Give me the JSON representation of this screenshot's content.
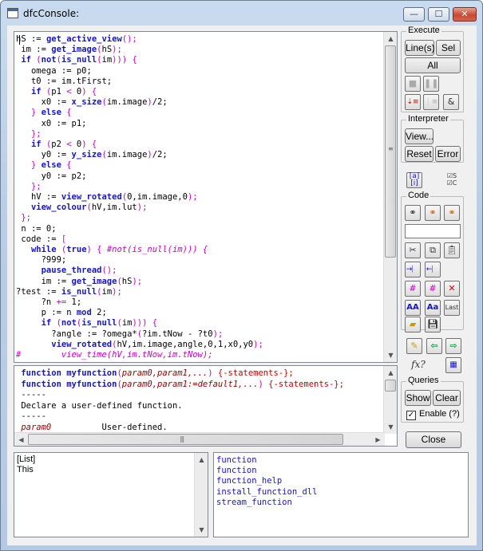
{
  "window": {
    "title": "dfcConsole:",
    "min": "—",
    "max": "☐",
    "close": "✕"
  },
  "editor": {
    "lines": [
      [
        [
          "",
          "hS := "
        ],
        [
          "fn",
          "get_active_view"
        ],
        [
          "sym",
          "();"
        ]
      ],
      [
        [
          "",
          " im := "
        ],
        [
          "fn",
          "get_image"
        ],
        [
          "sym",
          "("
        ],
        [
          "",
          "hS"
        ],
        [
          "sym",
          ");"
        ]
      ],
      [
        [
          "kw",
          " if"
        ],
        [
          "",
          " "
        ],
        [
          "sym",
          "("
        ],
        [
          "kw",
          "not"
        ],
        [
          "sym",
          "("
        ],
        [
          "kw",
          "is_null"
        ],
        [
          "sym",
          "("
        ],
        [
          "",
          "im"
        ],
        [
          "sym",
          "))) {"
        ]
      ],
      [
        [
          "",
          "   omega := p0;"
        ]
      ],
      [
        [
          "",
          "   t0 := im.tFirst;"
        ]
      ],
      [
        [
          "kw",
          "   if"
        ],
        [
          "",
          " "
        ],
        [
          "sym",
          "("
        ],
        [
          "",
          "p1 "
        ],
        [
          "sym",
          "<"
        ],
        [
          "",
          " 0"
        ],
        [
          "sym",
          ") {"
        ]
      ],
      [
        [
          "",
          "     x0 := "
        ],
        [
          "fn",
          "x_size"
        ],
        [
          "sym",
          "("
        ],
        [
          "",
          "im.image"
        ],
        [
          "sym",
          ")"
        ],
        [
          "",
          "/2;"
        ]
      ],
      [
        [
          "sym",
          "   } "
        ],
        [
          "kw",
          "else"
        ],
        [
          "sym",
          " {"
        ]
      ],
      [
        [
          "",
          "     x0 := p1;"
        ]
      ],
      [
        [
          "sym",
          "   };"
        ]
      ],
      [
        [
          "kw",
          "   if"
        ],
        [
          "",
          " "
        ],
        [
          "sym",
          "("
        ],
        [
          "",
          "p2 "
        ],
        [
          "sym",
          "<"
        ],
        [
          "",
          " 0"
        ],
        [
          "sym",
          ") {"
        ]
      ],
      [
        [
          "",
          "     y0 := "
        ],
        [
          "fn",
          "y_size"
        ],
        [
          "sym",
          "("
        ],
        [
          "",
          "im.image"
        ],
        [
          "sym",
          ")"
        ],
        [
          "",
          "/2;"
        ]
      ],
      [
        [
          "sym",
          "   } "
        ],
        [
          "kw",
          "else"
        ],
        [
          "sym",
          " {"
        ]
      ],
      [
        [
          "",
          "     y0 := p2;"
        ]
      ],
      [
        [
          "sym",
          "   };"
        ]
      ],
      [
        [
          "",
          "   hV := "
        ],
        [
          "fn",
          "view_rotated"
        ],
        [
          "sym",
          "("
        ],
        [
          "",
          "0,im.image,0"
        ],
        [
          "sym",
          ");"
        ]
      ],
      [
        [
          "fn",
          "   view_colour"
        ],
        [
          "sym",
          "("
        ],
        [
          "",
          "hV,im.lut"
        ],
        [
          "sym",
          ");"
        ]
      ],
      [
        [
          "sym",
          " };"
        ]
      ],
      [
        [
          "",
          " n := 0;"
        ]
      ],
      [
        [
          "",
          " code := "
        ],
        [
          "sym",
          "["
        ]
      ],
      [
        [
          "kw",
          "   while"
        ],
        [
          "",
          " "
        ],
        [
          "sym",
          "("
        ],
        [
          "kw",
          "true"
        ],
        [
          "sym",
          ") { "
        ],
        [
          "cm",
          "#not(is_null(im))) {"
        ]
      ],
      [
        [
          "",
          "     ?999;"
        ]
      ],
      [
        [
          "fn",
          "     pause_thread"
        ],
        [
          "sym",
          "();"
        ]
      ],
      [
        [
          "",
          "     im := "
        ],
        [
          "fn",
          "get_image"
        ],
        [
          "sym",
          "("
        ],
        [
          "",
          "hS"
        ],
        [
          "sym",
          ");"
        ]
      ],
      [
        [
          "dir",
          "?test"
        ],
        [
          "",
          " := "
        ],
        [
          "fn",
          "is_null"
        ],
        [
          "sym",
          "("
        ],
        [
          "",
          "im"
        ],
        [
          "sym",
          ");"
        ]
      ],
      [
        [
          "",
          "     ?n "
        ],
        [
          "sym",
          "+="
        ],
        [
          "",
          " 1;"
        ]
      ],
      [
        [
          "",
          "     p := n "
        ],
        [
          "kw",
          "mod"
        ],
        [
          "",
          " 2;"
        ]
      ],
      [
        [
          "kw",
          "     if"
        ],
        [
          "",
          " "
        ],
        [
          "sym",
          "("
        ],
        [
          "kw",
          "not"
        ],
        [
          "sym",
          "("
        ],
        [
          "kw",
          "is_null"
        ],
        [
          "sym",
          "("
        ],
        [
          "",
          "im"
        ],
        [
          "sym",
          "))) {"
        ]
      ],
      [
        [
          "",
          "       ?angle := ?omega*"
        ],
        [
          "sym",
          "("
        ],
        [
          "",
          "?im.tNow - ?t0"
        ],
        [
          "sym",
          ");"
        ]
      ],
      [
        [
          "fn",
          "       view_rotated"
        ],
        [
          "sym",
          "("
        ],
        [
          "",
          "hV,im.image,angle,0,1,x0,y0"
        ],
        [
          "sym",
          ");"
        ]
      ],
      [
        [
          "cm",
          "#        view_time(hV,im.tNow,im.tNow);"
        ]
      ]
    ]
  },
  "help": {
    "lines": [
      [
        [
          "fn",
          " function"
        ],
        [
          "",
          " "
        ],
        [
          "fn",
          "myfunction"
        ],
        [
          "sym",
          "("
        ],
        [
          "par",
          "param0,param1,..."
        ],
        [
          "sym",
          ")"
        ],
        [
          "",
          " "
        ],
        [
          "stmt",
          "{-statements-};"
        ]
      ],
      [
        [
          "fn",
          " function"
        ],
        [
          "",
          " "
        ],
        [
          "fn",
          "myfunction"
        ],
        [
          "sym",
          "("
        ],
        [
          "par",
          "param0,param1:=default1,..."
        ],
        [
          "sym",
          ")"
        ],
        [
          "",
          " "
        ],
        [
          "stmt",
          "{-statements-};"
        ]
      ],
      [
        [
          "",
          " -----"
        ]
      ],
      [
        [
          "",
          " Declare a user-defined function."
        ]
      ],
      [
        [
          "",
          " -----"
        ]
      ],
      [
        [
          "par",
          " param0"
        ],
        [
          "",
          "          User-defined."
        ]
      ]
    ]
  },
  "list_panel": {
    "lines": [
      "[List]",
      "This"
    ]
  },
  "completions": [
    "function",
    "function",
    "function_help",
    "install_function_dll",
    "stream_function"
  ],
  "execute": {
    "title": "Execute",
    "line_label": "Line(s)",
    "sel_label": "Sel",
    "all_label": "All",
    "icons": [
      "stop-icon",
      "pause-icon",
      "step-into-icon",
      "step-over-icon",
      "ampersand-icon"
    ]
  },
  "interpreter": {
    "title": "Interpreter",
    "view_label": "View...",
    "reset_label": "Reset",
    "error_label": "Error"
  },
  "toggles": [
    "list-toggle-icon",
    "select-checkbox-toggle-icon"
  ],
  "code": {
    "title": "Code"
  },
  "queries": {
    "title": "Queries",
    "show_label": "Show",
    "clear_label": "Clear",
    "enable_label": "Enable (?)"
  },
  "close_label": "Close"
}
